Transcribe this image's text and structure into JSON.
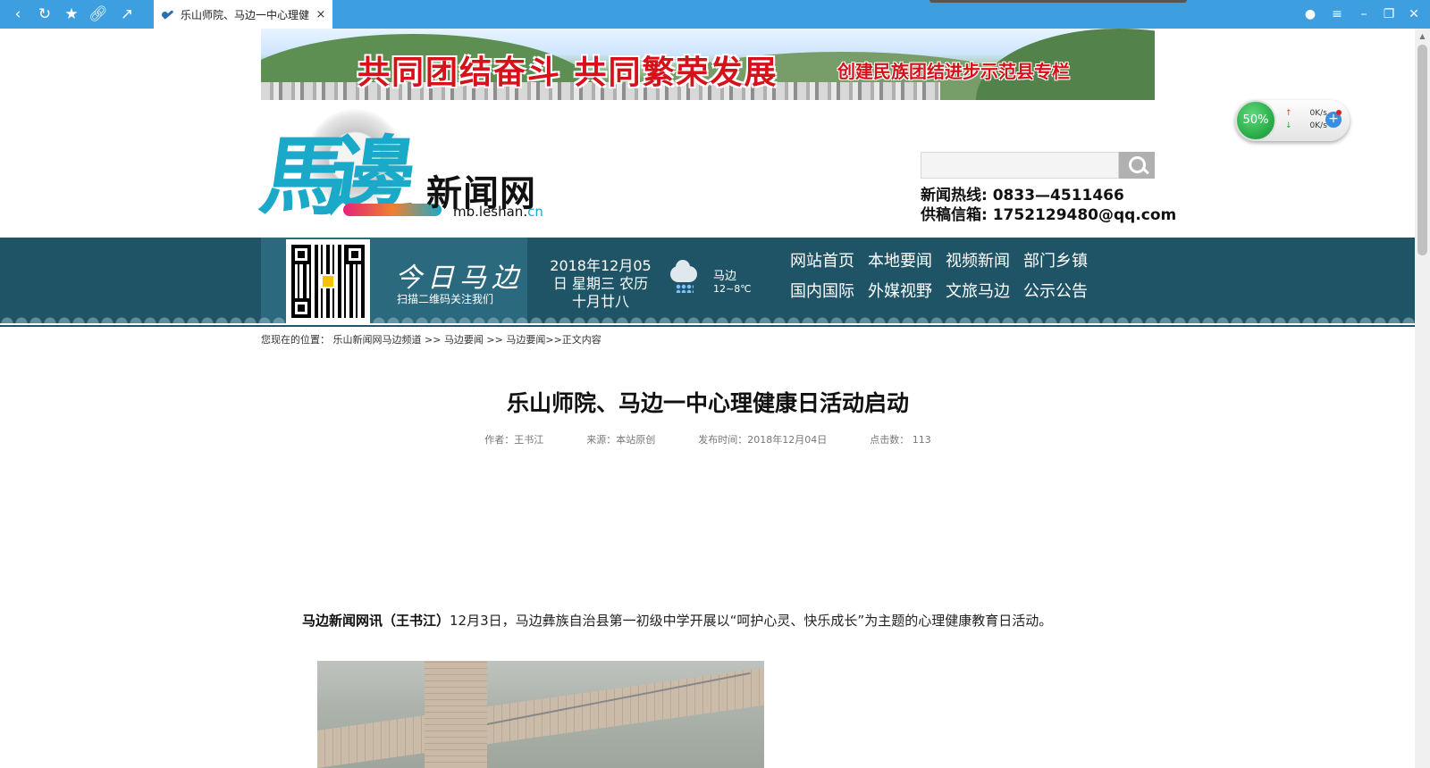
{
  "browser": {
    "tab_title": "乐山师院、马边一中心理健",
    "tab_close": "×",
    "icons": [
      "back-icon",
      "refresh-icon",
      "bookmark-icon",
      "link-icon",
      "share-icon",
      "account-icon",
      "menu-icon",
      "minimize-icon",
      "restore-icon",
      "close-icon"
    ]
  },
  "banner": {
    "slogan": "共同团结奋斗  共同繁荣发展",
    "sub_slogan": "创建民族团结进步示范县专栏"
  },
  "logo": {
    "calligraphy": "馬邊",
    "site_name": "新闻网",
    "domain_main": "mb.leshan.",
    "domain_cn": "cn"
  },
  "search": {
    "placeholder": "",
    "value": ""
  },
  "contact": {
    "hotline": "新闻热线: 0833—4511466",
    "email": "供稿信箱: 1752129480@qq.com"
  },
  "today": {
    "title": "今日马边",
    "subtitle": "扫描二维码关注我们"
  },
  "date": {
    "line1": "2018年12月05",
    "line2": "日 星期三 农历",
    "line3": "十月廿八"
  },
  "weather": {
    "city": "马边",
    "temp": "12~8℃"
  },
  "menu": [
    "网站首页",
    "本地要闻",
    "视频新闻",
    "部门乡镇",
    "国内国际",
    "外媒视野",
    "文旅马边",
    "公示公告"
  ],
  "breadcrumb": {
    "prefix": "您现在的位置：",
    "items": [
      "乐山新闻网马边频道",
      "马边要闻",
      "马边要闻"
    ],
    "separator": " >> ",
    "tail": ">>正文内容"
  },
  "article": {
    "title": "乐山师院、马边一中心理健康日活动启动",
    "author": "作者：王书江",
    "source": "来源：本站原创",
    "published": "发布时间：2018年12月04日",
    "views": "点击数： 113",
    "lead_bold": "马边新闻网讯（王书江）",
    "lead_text": "12月3日，马边彝族自治县第一初级中学开展以“呵护心灵、快乐成长”为主题的心理健康教育日活动。"
  },
  "net_widget": {
    "percent": "50%",
    "up_speed": "0K/s",
    "down_speed": "0K/s"
  },
  "colors": {
    "chrome": "#3d9fe0",
    "nav_band": "#1f5466",
    "accent_red": "#d5121a",
    "logo_teal": "#1aa9c9"
  }
}
